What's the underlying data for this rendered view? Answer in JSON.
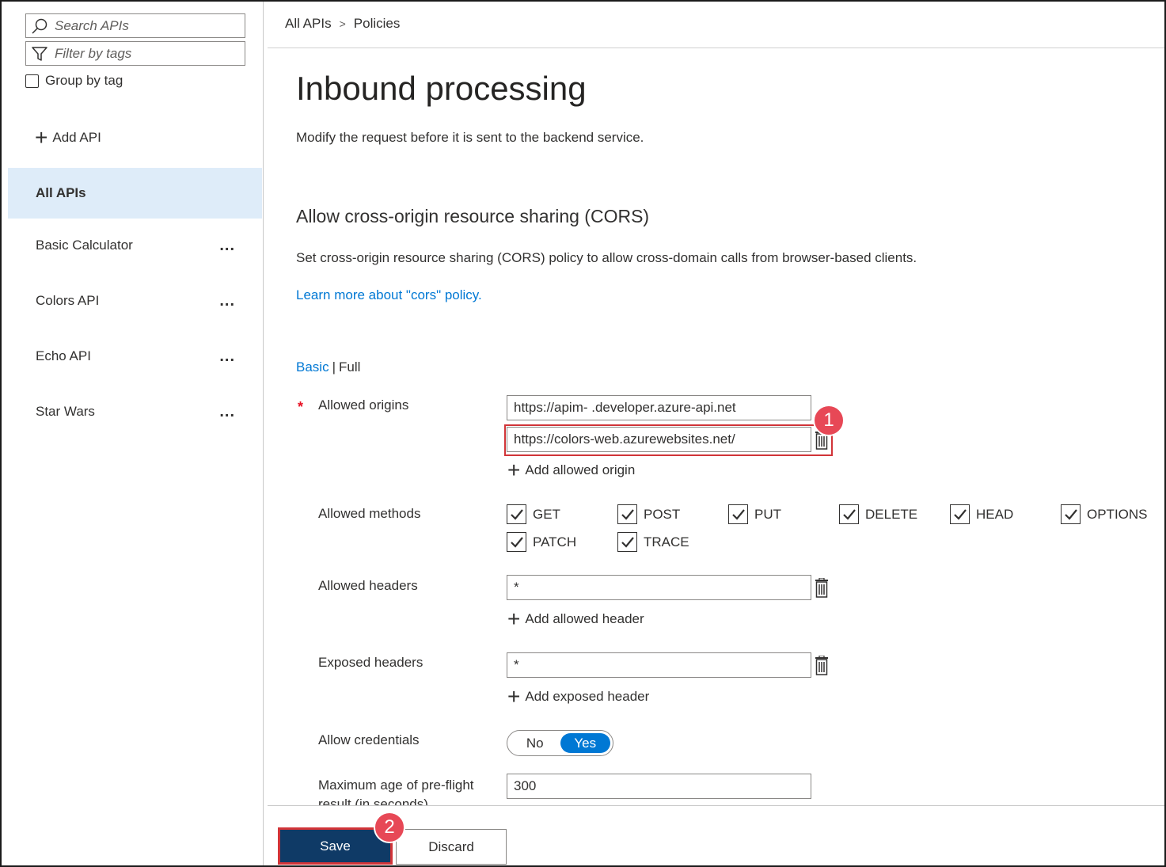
{
  "sidebar": {
    "search_placeholder": "Search APIs",
    "filter_placeholder": "Filter by tags",
    "group_by_tag_label": "Group by tag",
    "add_api_label": "Add API",
    "items": [
      {
        "label": "All APIs",
        "selected": true
      },
      {
        "label": "Basic Calculator",
        "more": "..."
      },
      {
        "label": "Colors API",
        "more": "..."
      },
      {
        "label": "Echo API",
        "more": "..."
      },
      {
        "label": "Star Wars",
        "more": "..."
      }
    ]
  },
  "breadcrumb": {
    "root": "All APIs",
    "separator": ">",
    "current": "Policies"
  },
  "page": {
    "title": "Inbound processing",
    "subtitle": "Modify the request before it is sent to the backend service."
  },
  "cors": {
    "section_title": "Allow cross-origin resource sharing (CORS)",
    "description": "Set cross-origin resource sharing (CORS) policy to allow cross-domain calls from browser-based clients.",
    "learn_more": "Learn more about \"cors\" policy.",
    "mode_basic": "Basic",
    "mode_separator": "|",
    "mode_full": "Full",
    "required_marker": "*",
    "allowed_origins_label": "Allowed origins",
    "origin_1": "https://apim-           .developer.azure-api.net",
    "origin_2": "https://colors-web.azurewebsites.net/",
    "add_origin_label": "Add allowed origin",
    "allowed_methods_label": "Allowed methods",
    "methods": [
      "GET",
      "POST",
      "PUT",
      "DELETE",
      "HEAD",
      "OPTIONS",
      "PATCH",
      "TRACE"
    ],
    "allowed_headers_label": "Allowed headers",
    "allowed_headers_value": "*",
    "add_header_label": "Add allowed header",
    "exposed_headers_label": "Exposed headers",
    "exposed_headers_value": "*",
    "add_exposed_label": "Add exposed header",
    "allow_credentials_label": "Allow credentials",
    "credentials_no": "No",
    "credentials_yes": "Yes",
    "max_age_label_line1": "Maximum age of pre-flight",
    "max_age_label_line2": "result (in seconds)",
    "max_age_value": "300"
  },
  "footer": {
    "save_label": "Save",
    "discard_label": "Discard"
  },
  "callouts": {
    "step_1": "1",
    "step_2": "2"
  },
  "colors": {
    "accent": "#0078d4",
    "save_bg": "#0f3a66",
    "highlight": "#d13438",
    "badge": "#e74856",
    "selected_bg": "#deecf9"
  }
}
